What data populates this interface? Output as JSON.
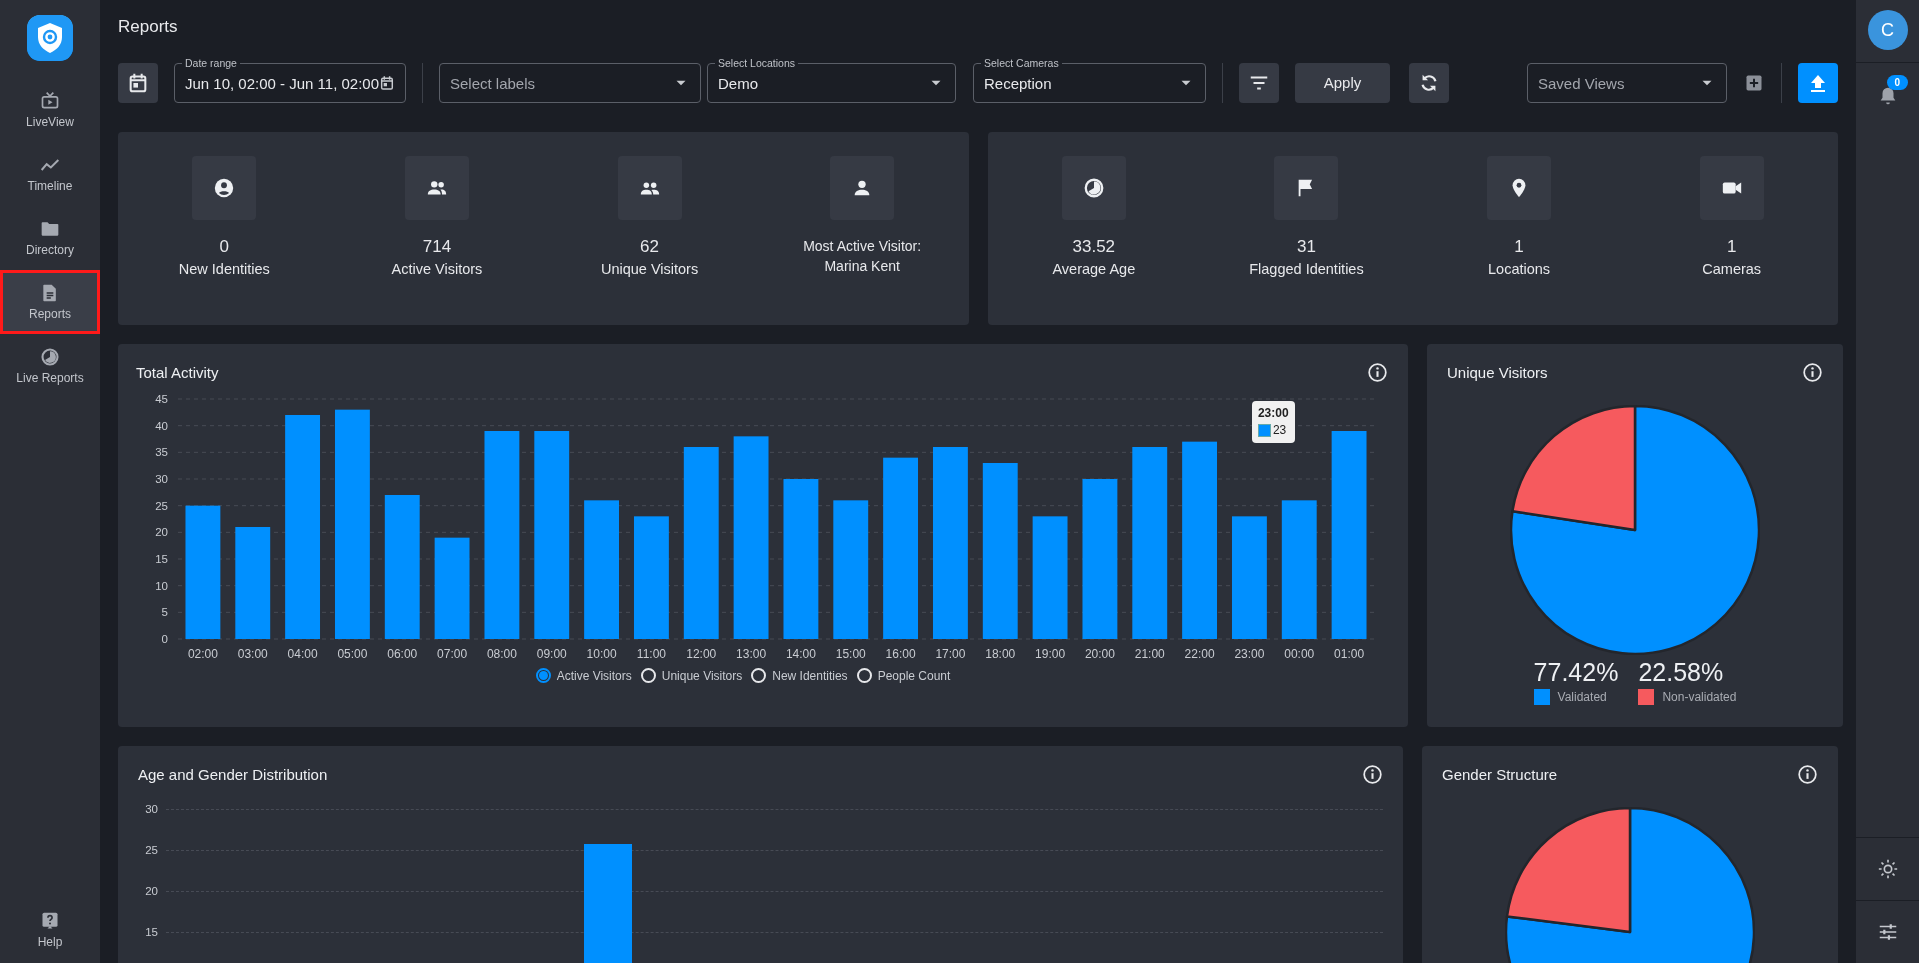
{
  "sidebar": {
    "items": [
      {
        "label": "LiveView",
        "selected": false
      },
      {
        "label": "Timeline",
        "selected": false
      },
      {
        "label": "Directory",
        "selected": false
      },
      {
        "label": "Reports",
        "selected": true
      },
      {
        "label": "Live Reports",
        "selected": false
      }
    ],
    "help": "Help"
  },
  "page_title": "Reports",
  "toolbar": {
    "date_range": {
      "label": "Date range",
      "value": "Jun 10, 02:00 - Jun 11, 02:00"
    },
    "labels_select": {
      "placeholder": "Select labels"
    },
    "locations_select": {
      "label": "Select Locations",
      "value": "Demo"
    },
    "cameras_select": {
      "label": "Select Cameras",
      "value": "Reception"
    },
    "apply_button": "Apply",
    "saved_views": {
      "placeholder": "Saved Views"
    }
  },
  "stat_cards": [
    {
      "items": [
        {
          "kind": "count",
          "value": "0",
          "label": "New Identities"
        },
        {
          "kind": "count",
          "value": "714",
          "label": "Active Visitors"
        },
        {
          "kind": "count",
          "value": "62",
          "label": "Unique Visitors"
        },
        {
          "kind": "named",
          "label": "Most Active Visitor:",
          "value": "Marina Kent"
        }
      ]
    },
    {
      "items": [
        {
          "kind": "count",
          "value": "33.52",
          "label": "Average Age"
        },
        {
          "kind": "count",
          "value": "31",
          "label": "Flagged Identities"
        },
        {
          "kind": "count",
          "value": "1",
          "label": "Locations"
        },
        {
          "kind": "count",
          "value": "1",
          "label": "Cameras"
        }
      ]
    }
  ],
  "total_activity": {
    "title": "Total Activity",
    "chart_data": {
      "type": "bar",
      "categories": [
        "02:00",
        "03:00",
        "04:00",
        "05:00",
        "06:00",
        "07:00",
        "08:00",
        "09:00",
        "10:00",
        "11:00",
        "12:00",
        "13:00",
        "14:00",
        "15:00",
        "16:00",
        "17:00",
        "18:00",
        "19:00",
        "20:00",
        "21:00",
        "22:00",
        "23:00",
        "00:00",
        "01:00"
      ],
      "grid": true,
      "series": [
        {
          "color": "#0090ff",
          "values": [
            25,
            21,
            42,
            43,
            27,
            19,
            39,
            39,
            26,
            23,
            36,
            38,
            30,
            26,
            34,
            36,
            33,
            23,
            30,
            36,
            37,
            23,
            26,
            39
          ]
        }
      ],
      "ylim": [
        0,
        45
      ],
      "yticks": [
        0,
        5,
        10,
        15,
        20,
        25,
        30,
        35,
        40,
        45
      ]
    },
    "tooltip": {
      "title": "23:00",
      "value": "23"
    },
    "legend": [
      {
        "label": "Active Visitors",
        "selected": true
      },
      {
        "label": "Unique Visitors",
        "selected": false
      },
      {
        "label": "New Identities",
        "selected": false
      },
      {
        "label": "People Count",
        "selected": false
      }
    ]
  },
  "unique_visitors": {
    "title": "Unique Visitors",
    "chart_data": {
      "type": "pie",
      "categories": [
        "Validated",
        "Non-validated"
      ],
      "values": [
        77.42,
        22.58
      ]
    },
    "legend": [
      {
        "value": "77.42%",
        "color": "#0090ff"
      },
      {
        "value": "22.58%",
        "color": "#f65a5e"
      }
    ]
  },
  "age_gender": {
    "title": "Age and Gender Distribution",
    "y_axis_labels": [
      "30",
      "25",
      "20",
      "15"
    ]
  },
  "gender_structure": {
    "title": "Gender Structure"
  },
  "right_rail": {
    "avatar": "C",
    "notifications": "0"
  }
}
